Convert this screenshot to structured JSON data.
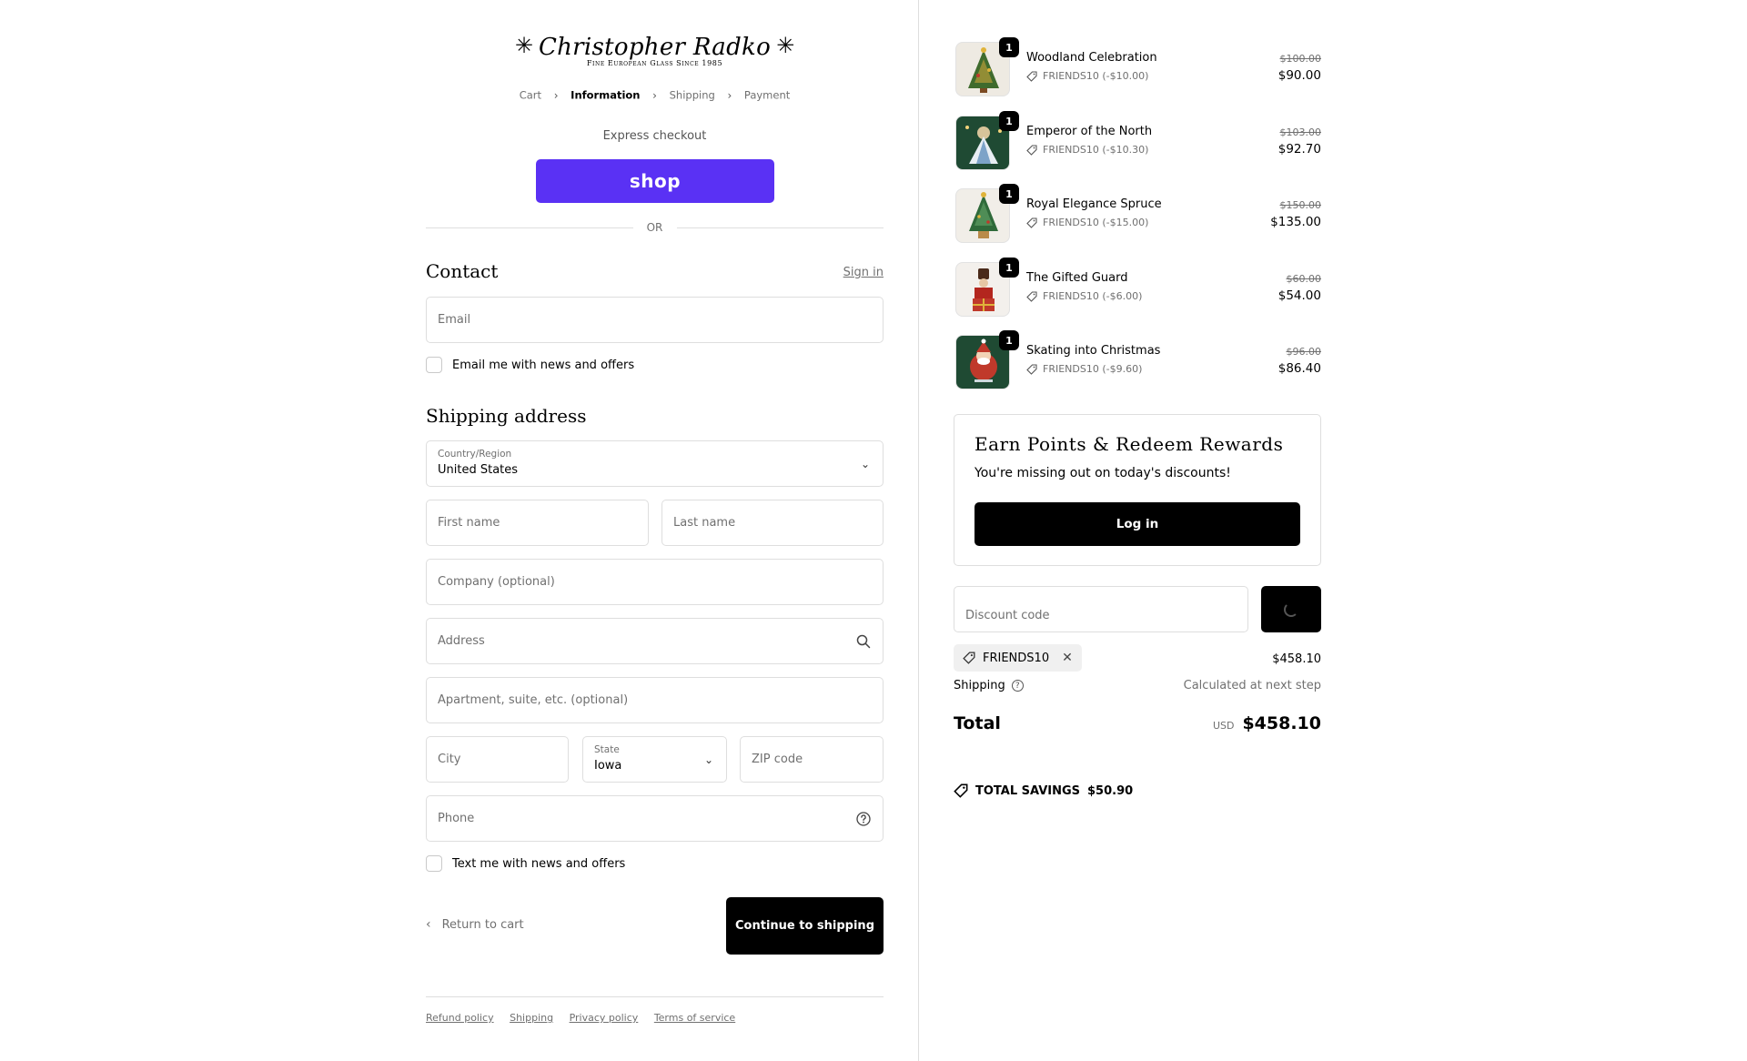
{
  "brand": {
    "name": "Christopher Radko",
    "tagline": "Fine European Glass Since 1985"
  },
  "breadcrumb": {
    "cart": "Cart",
    "information": "Information",
    "shipping": "Shipping",
    "payment": "Payment"
  },
  "express": {
    "label": "Express checkout",
    "shop_button": "shop",
    "or": "OR"
  },
  "contact": {
    "heading": "Contact",
    "sign_in": "Sign in",
    "email_placeholder": "Email",
    "email_opt_in": "Email me with news and offers"
  },
  "shipping_address": {
    "heading": "Shipping address",
    "country_label": "Country/Region",
    "country_value": "United States",
    "first_name": "First name",
    "last_name": "Last name",
    "company": "Company (optional)",
    "address": "Address",
    "apartment": "Apartment, suite, etc. (optional)",
    "city": "City",
    "state_label": "State",
    "state_value": "Iowa",
    "zip": "ZIP code",
    "phone": "Phone",
    "sms_opt_in": "Text me with news and offers"
  },
  "actions": {
    "return": "Return to cart",
    "continue": "Continue to shipping"
  },
  "footer": {
    "refund": "Refund policy",
    "shipping": "Shipping",
    "privacy": "Privacy policy",
    "terms": "Terms of service"
  },
  "items": [
    {
      "name": "Woodland Celebration",
      "qty": "1",
      "discount": "FRIENDS10 (-$10.00)",
      "original": "$100.00",
      "price": "$90.00"
    },
    {
      "name": "Emperor of the North",
      "qty": "1",
      "discount": "FRIENDS10 (-$10.30)",
      "original": "$103.00",
      "price": "$92.70"
    },
    {
      "name": "Royal Elegance Spruce",
      "qty": "1",
      "discount": "FRIENDS10 (-$15.00)",
      "original": "$150.00",
      "price": "$135.00"
    },
    {
      "name": "The Gifted Guard",
      "qty": "1",
      "discount": "FRIENDS10 (-$6.00)",
      "original": "$60.00",
      "price": "$54.00"
    },
    {
      "name": "Skating into Christmas",
      "qty": "1",
      "discount": "FRIENDS10 (-$9.60)",
      "original": "$96.00",
      "price": "$86.40"
    }
  ],
  "rewards": {
    "title": "Earn Points & Redeem Rewards",
    "subtitle": "You're missing out on today's discounts!",
    "login": "Log in"
  },
  "summary": {
    "discount_placeholder": "Discount code",
    "applied_code": "FRIENDS10",
    "subtotal": "$458.10",
    "shipping_label": "Shipping",
    "shipping_value": "Calculated at next step",
    "total_label": "Total",
    "currency": "USD",
    "total": "$458.10",
    "savings_label": "TOTAL SAVINGS",
    "savings_value": "$50.90"
  },
  "colors": {
    "shop_purple": "#5a31f4",
    "primary_button": "#000000",
    "border": "#dedede"
  }
}
